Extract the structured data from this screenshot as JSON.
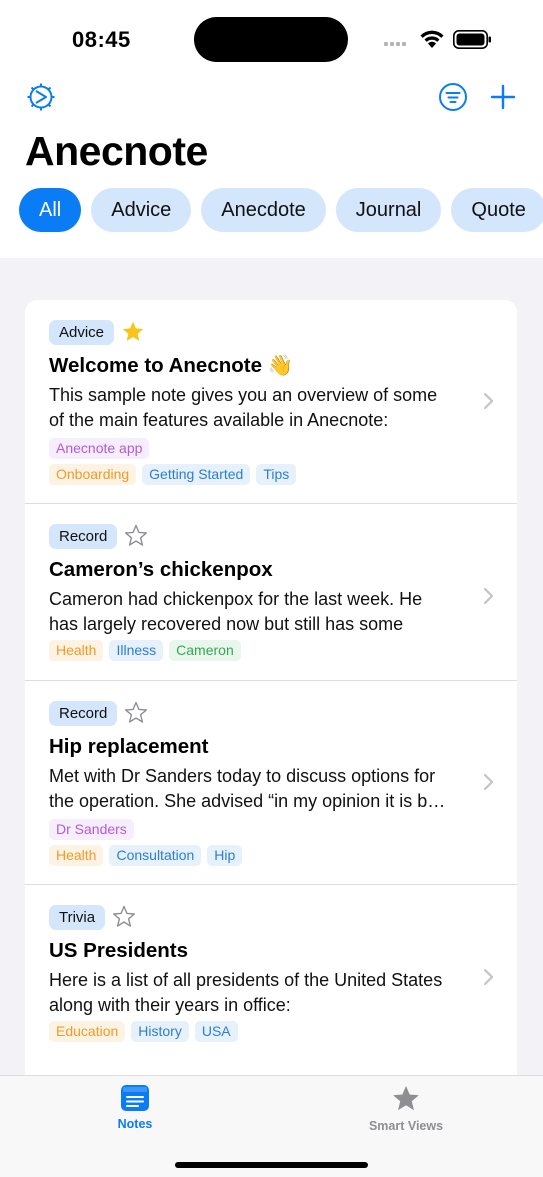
{
  "status_bar": {
    "time": "08:45"
  },
  "header": {
    "title": "Anecnote",
    "icons": {
      "settings": "gear-icon",
      "filter": "filter-icon",
      "add": "plus-icon"
    },
    "chips": [
      "All",
      "Advice",
      "Anecdote",
      "Journal",
      "Quote"
    ],
    "selected_chip": "All"
  },
  "notes": [
    {
      "type": "Advice",
      "starred": true,
      "title": "Welcome to Anecnote 👋",
      "body_line1": "This sample note gives you an overview of some",
      "body_line2": "of the main features available in Anecnote:",
      "people": [
        "Anecnote app"
      ],
      "tags": [
        "Onboarding",
        "Getting Started",
        "Tips"
      ]
    },
    {
      "type": "Record",
      "starred": false,
      "title": "Cameron’s chickenpox",
      "body_line1": "Cameron had chickenpox for the last week. He",
      "body_line2": "has largely recovered now but still has some",
      "tags": [
        "Health",
        "Illness",
        "Cameron"
      ]
    },
    {
      "type": "Record",
      "starred": false,
      "title": "Hip replacement",
      "body_line1": "Met with Dr Sanders today to discuss options for",
      "body_line2": "the operation. She advised “in my opinion it is b…",
      "people": [
        "Dr Sanders"
      ],
      "tags": [
        "Health",
        "Consultation",
        "Hip"
      ]
    },
    {
      "type": "Trivia",
      "starred": false,
      "title": "US Presidents",
      "body_line1": "Here is a list of all presidents of the United States",
      "body_line2": "along with their years in office:",
      "tags": [
        "Education",
        "History",
        "USA"
      ]
    }
  ],
  "tabbar": {
    "tabs": [
      {
        "label": "Notes",
        "icon": "notes-icon",
        "active": true
      },
      {
        "label": "Smart Views",
        "icon": "star-icon",
        "active": false
      }
    ]
  },
  "colors": {
    "accent": "#0a7cf5",
    "chip_bg": "#d3e6fb",
    "star_gold": "#f5c518",
    "background": "#f2f2f7"
  }
}
